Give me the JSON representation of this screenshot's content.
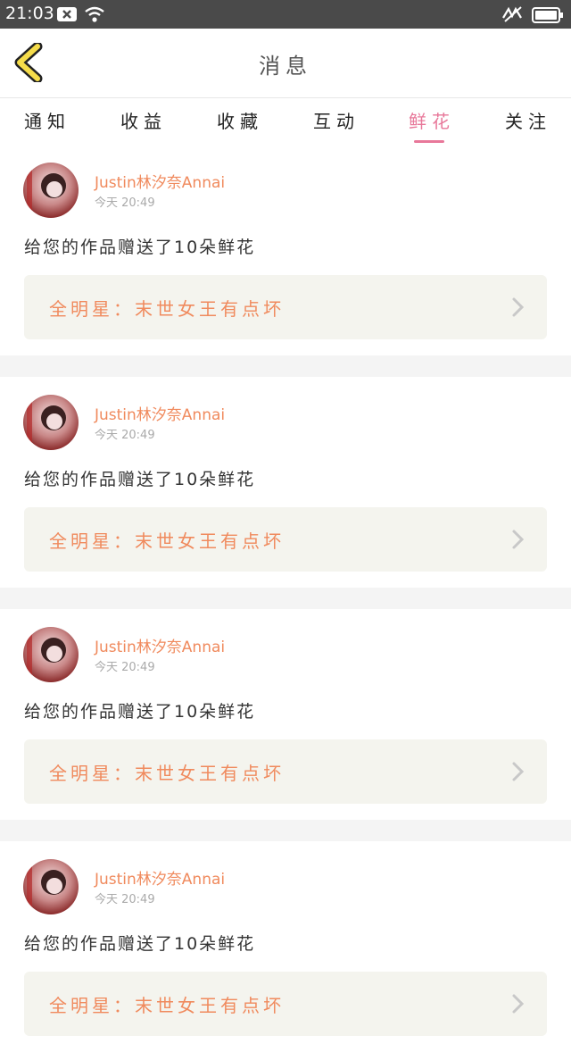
{
  "status_bar": {
    "time": "21:03"
  },
  "nav": {
    "title": "消息",
    "back_icon": "chevron-left-icon"
  },
  "tabs": [
    {
      "label": "通知",
      "active": false
    },
    {
      "label": "收益",
      "active": false
    },
    {
      "label": "收藏",
      "active": false
    },
    {
      "label": "互动",
      "active": false
    },
    {
      "label": "鲜花",
      "active": true
    },
    {
      "label": "关注",
      "active": false
    }
  ],
  "colors": {
    "accent": "#e8789a",
    "orange": "#f08a5d",
    "card_bg": "#f4f4ee"
  },
  "items": [
    {
      "username": "Justin林汐奈Annai",
      "time": "今天 20:49",
      "message": "给您的作品赠送了10朵鲜花",
      "work": "全明星：末世女王有点坏"
    },
    {
      "username": "Justin林汐奈Annai",
      "time": "今天 20:49",
      "message": "给您的作品赠送了10朵鲜花",
      "work": "全明星：末世女王有点坏"
    },
    {
      "username": "Justin林汐奈Annai",
      "time": "今天 20:49",
      "message": "给您的作品赠送了10朵鲜花",
      "work": "全明星：末世女王有点坏"
    },
    {
      "username": "Justin林汐奈Annai",
      "time": "今天 20:49",
      "message": "给您的作品赠送了10朵鲜花",
      "work": "全明星：末世女王有点坏"
    }
  ]
}
